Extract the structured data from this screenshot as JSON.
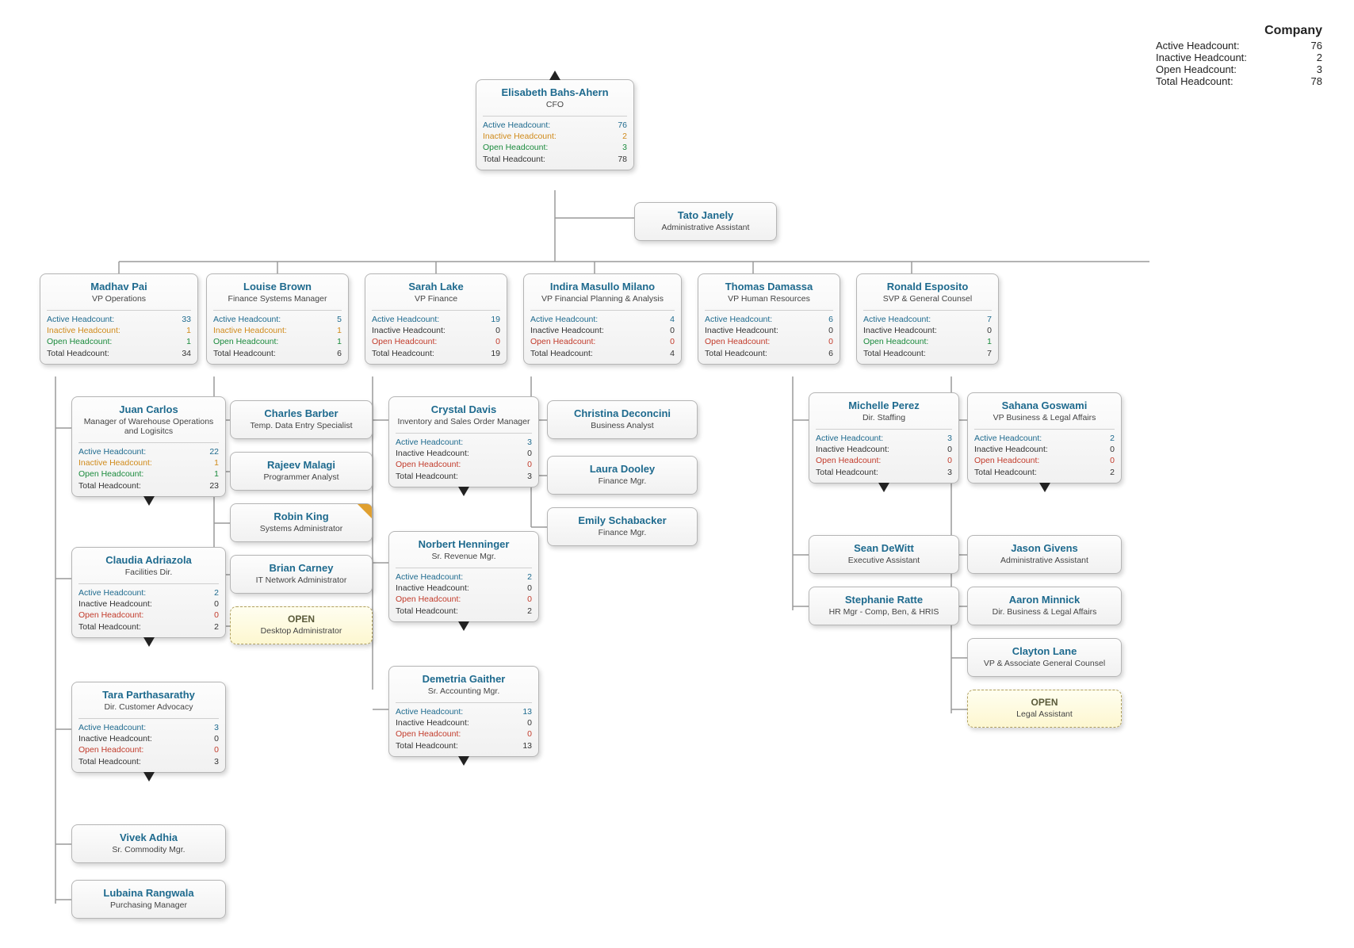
{
  "summary": {
    "title": "Company",
    "rows": [
      {
        "label": "Active Headcount:",
        "value": 76
      },
      {
        "label": "Inactive Headcount:",
        "value": 2
      },
      {
        "label": "Open Headcount:",
        "value": 3
      },
      {
        "label": "Total Headcount:",
        "value": 78
      }
    ]
  },
  "labels": {
    "active": "Active Headcount:",
    "inactive": "Inactive Headcount:",
    "open": "Open Headcount:",
    "total": "Total Headcount:"
  },
  "nodes": {
    "cfo": {
      "name": "Elisabeth Bahs-Ahern",
      "title": "CFO",
      "counts": {
        "active": 76,
        "inactive": 2,
        "open": 3,
        "total": 78
      }
    },
    "tato": {
      "name": "Tato Janely",
      "title": "Administrative Assistant"
    },
    "madhav": {
      "name": "Madhav Pai",
      "title": "VP Operations",
      "counts": {
        "active": 33,
        "inactive": 1,
        "open": 1,
        "total": 34
      }
    },
    "louise": {
      "name": "Louise Brown",
      "title": "Finance Systems Manager",
      "counts": {
        "active": 5,
        "inactive": 1,
        "open": 1,
        "total": 6
      }
    },
    "sarah": {
      "name": "Sarah Lake",
      "title": "VP Finance",
      "counts": {
        "active": 19,
        "inactive": 0,
        "open": 0,
        "total": 19
      }
    },
    "indira": {
      "name": "Indira Masullo Milano",
      "title": "VP Financial Planning & Analysis",
      "counts": {
        "active": 4,
        "inactive": 0,
        "open": 0,
        "total": 4
      }
    },
    "thomas": {
      "name": "Thomas Damassa",
      "title": "VP Human Resources",
      "counts": {
        "active": 6,
        "inactive": 0,
        "open": 0,
        "total": 6
      }
    },
    "ronald": {
      "name": "Ronald Esposito",
      "title": "SVP & General Counsel",
      "counts": {
        "active": 7,
        "inactive": 0,
        "open": 1,
        "total": 7
      }
    },
    "juan": {
      "name": "Juan Carlos",
      "title": "Manager of Warehouse Operations and Logisitcs",
      "counts": {
        "active": 22,
        "inactive": 1,
        "open": 1,
        "total": 23
      }
    },
    "claudia": {
      "name": "Claudia Adriazola",
      "title": "Facilities Dir.",
      "counts": {
        "active": 2,
        "inactive": 0,
        "open": 0,
        "total": 2
      }
    },
    "tara": {
      "name": "Tara Parthasarathy",
      "title": "Dir. Customer Advocacy",
      "counts": {
        "active": 3,
        "inactive": 0,
        "open": 0,
        "total": 3
      }
    },
    "vivek": {
      "name": "Vivek Adhia",
      "title": "Sr. Commodity Mgr."
    },
    "lubaina": {
      "name": "Lubaina Rangwala",
      "title": "Purchasing Manager"
    },
    "charles": {
      "name": "Charles Barber",
      "title": "Temp. Data Entry Specialist"
    },
    "rajeev": {
      "name": "Rajeev Malagi",
      "title": "Programmer Analyst"
    },
    "robin": {
      "name": "Robin King",
      "title": "Systems Administrator"
    },
    "brian": {
      "name": "Brian Carney",
      "title": "IT Network Administrator"
    },
    "open1": {
      "name": "OPEN",
      "title": "Desktop Administrator"
    },
    "crystal": {
      "name": "Crystal Davis",
      "title": "Inventory and Sales Order Manager",
      "counts": {
        "active": 3,
        "inactive": 0,
        "open": 0,
        "total": 3
      }
    },
    "norbert": {
      "name": "Norbert Henninger",
      "title": "Sr. Revenue Mgr.",
      "counts": {
        "active": 2,
        "inactive": 0,
        "open": 0,
        "total": 2
      }
    },
    "demetria": {
      "name": "Demetria Gaither",
      "title": "Sr. Accounting Mgr.",
      "counts": {
        "active": 13,
        "inactive": 0,
        "open": 0,
        "total": 13
      }
    },
    "christina": {
      "name": "Christina Deconcini",
      "title": "Business Analyst"
    },
    "laura": {
      "name": "Laura Dooley",
      "title": "Finance Mgr."
    },
    "emily": {
      "name": "Emily Schabacker",
      "title": "Finance Mgr."
    },
    "michelle": {
      "name": "Michelle Perez",
      "title": "Dir. Staffing",
      "counts": {
        "active": 3,
        "inactive": 0,
        "open": 0,
        "total": 3
      }
    },
    "sean": {
      "name": "Sean DeWitt",
      "title": "Executive Assistant"
    },
    "stephanie": {
      "name": "Stephanie Ratte",
      "title": "HR Mgr - Comp, Ben, & HRIS"
    },
    "sahana": {
      "name": "Sahana Goswami",
      "title": "VP Business & Legal Affairs",
      "counts": {
        "active": 2,
        "inactive": 0,
        "open": 0,
        "total": 2
      }
    },
    "jason": {
      "name": "Jason Givens",
      "title": "Administrative Assistant"
    },
    "aaron": {
      "name": "Aaron Minnick",
      "title": "Dir. Business & Legal Affairs"
    },
    "clayton": {
      "name": "Clayton Lane",
      "title": "VP & Associate General Counsel"
    },
    "open2": {
      "name": "OPEN",
      "title": "Legal Assistant"
    }
  },
  "chart_data": {
    "type": "org-chart",
    "root": "cfo",
    "assistant_of": {
      "tato": "cfo"
    },
    "edges": [
      [
        "cfo",
        "madhav"
      ],
      [
        "cfo",
        "louise"
      ],
      [
        "cfo",
        "sarah"
      ],
      [
        "cfo",
        "indira"
      ],
      [
        "cfo",
        "thomas"
      ],
      [
        "cfo",
        "ronald"
      ],
      [
        "madhav",
        "juan"
      ],
      [
        "madhav",
        "claudia"
      ],
      [
        "madhav",
        "tara"
      ],
      [
        "madhav",
        "vivek"
      ],
      [
        "madhav",
        "lubaina"
      ],
      [
        "louise",
        "charles"
      ],
      [
        "louise",
        "rajeev"
      ],
      [
        "louise",
        "robin"
      ],
      [
        "louise",
        "brian"
      ],
      [
        "louise",
        "open1"
      ],
      [
        "sarah",
        "crystal"
      ],
      [
        "sarah",
        "norbert"
      ],
      [
        "sarah",
        "demetria"
      ],
      [
        "indira",
        "christina"
      ],
      [
        "indira",
        "laura"
      ],
      [
        "indira",
        "emily"
      ],
      [
        "thomas",
        "michelle"
      ],
      [
        "thomas",
        "sean"
      ],
      [
        "thomas",
        "stephanie"
      ],
      [
        "ronald",
        "sahana"
      ],
      [
        "ronald",
        "jason"
      ],
      [
        "ronald",
        "aaron"
      ],
      [
        "ronald",
        "clayton"
      ],
      [
        "ronald",
        "open2"
      ]
    ],
    "collapsed_children_indicator": [
      "juan",
      "claudia",
      "tara",
      "crystal",
      "norbert",
      "demetria",
      "michelle",
      "sahana"
    ]
  }
}
